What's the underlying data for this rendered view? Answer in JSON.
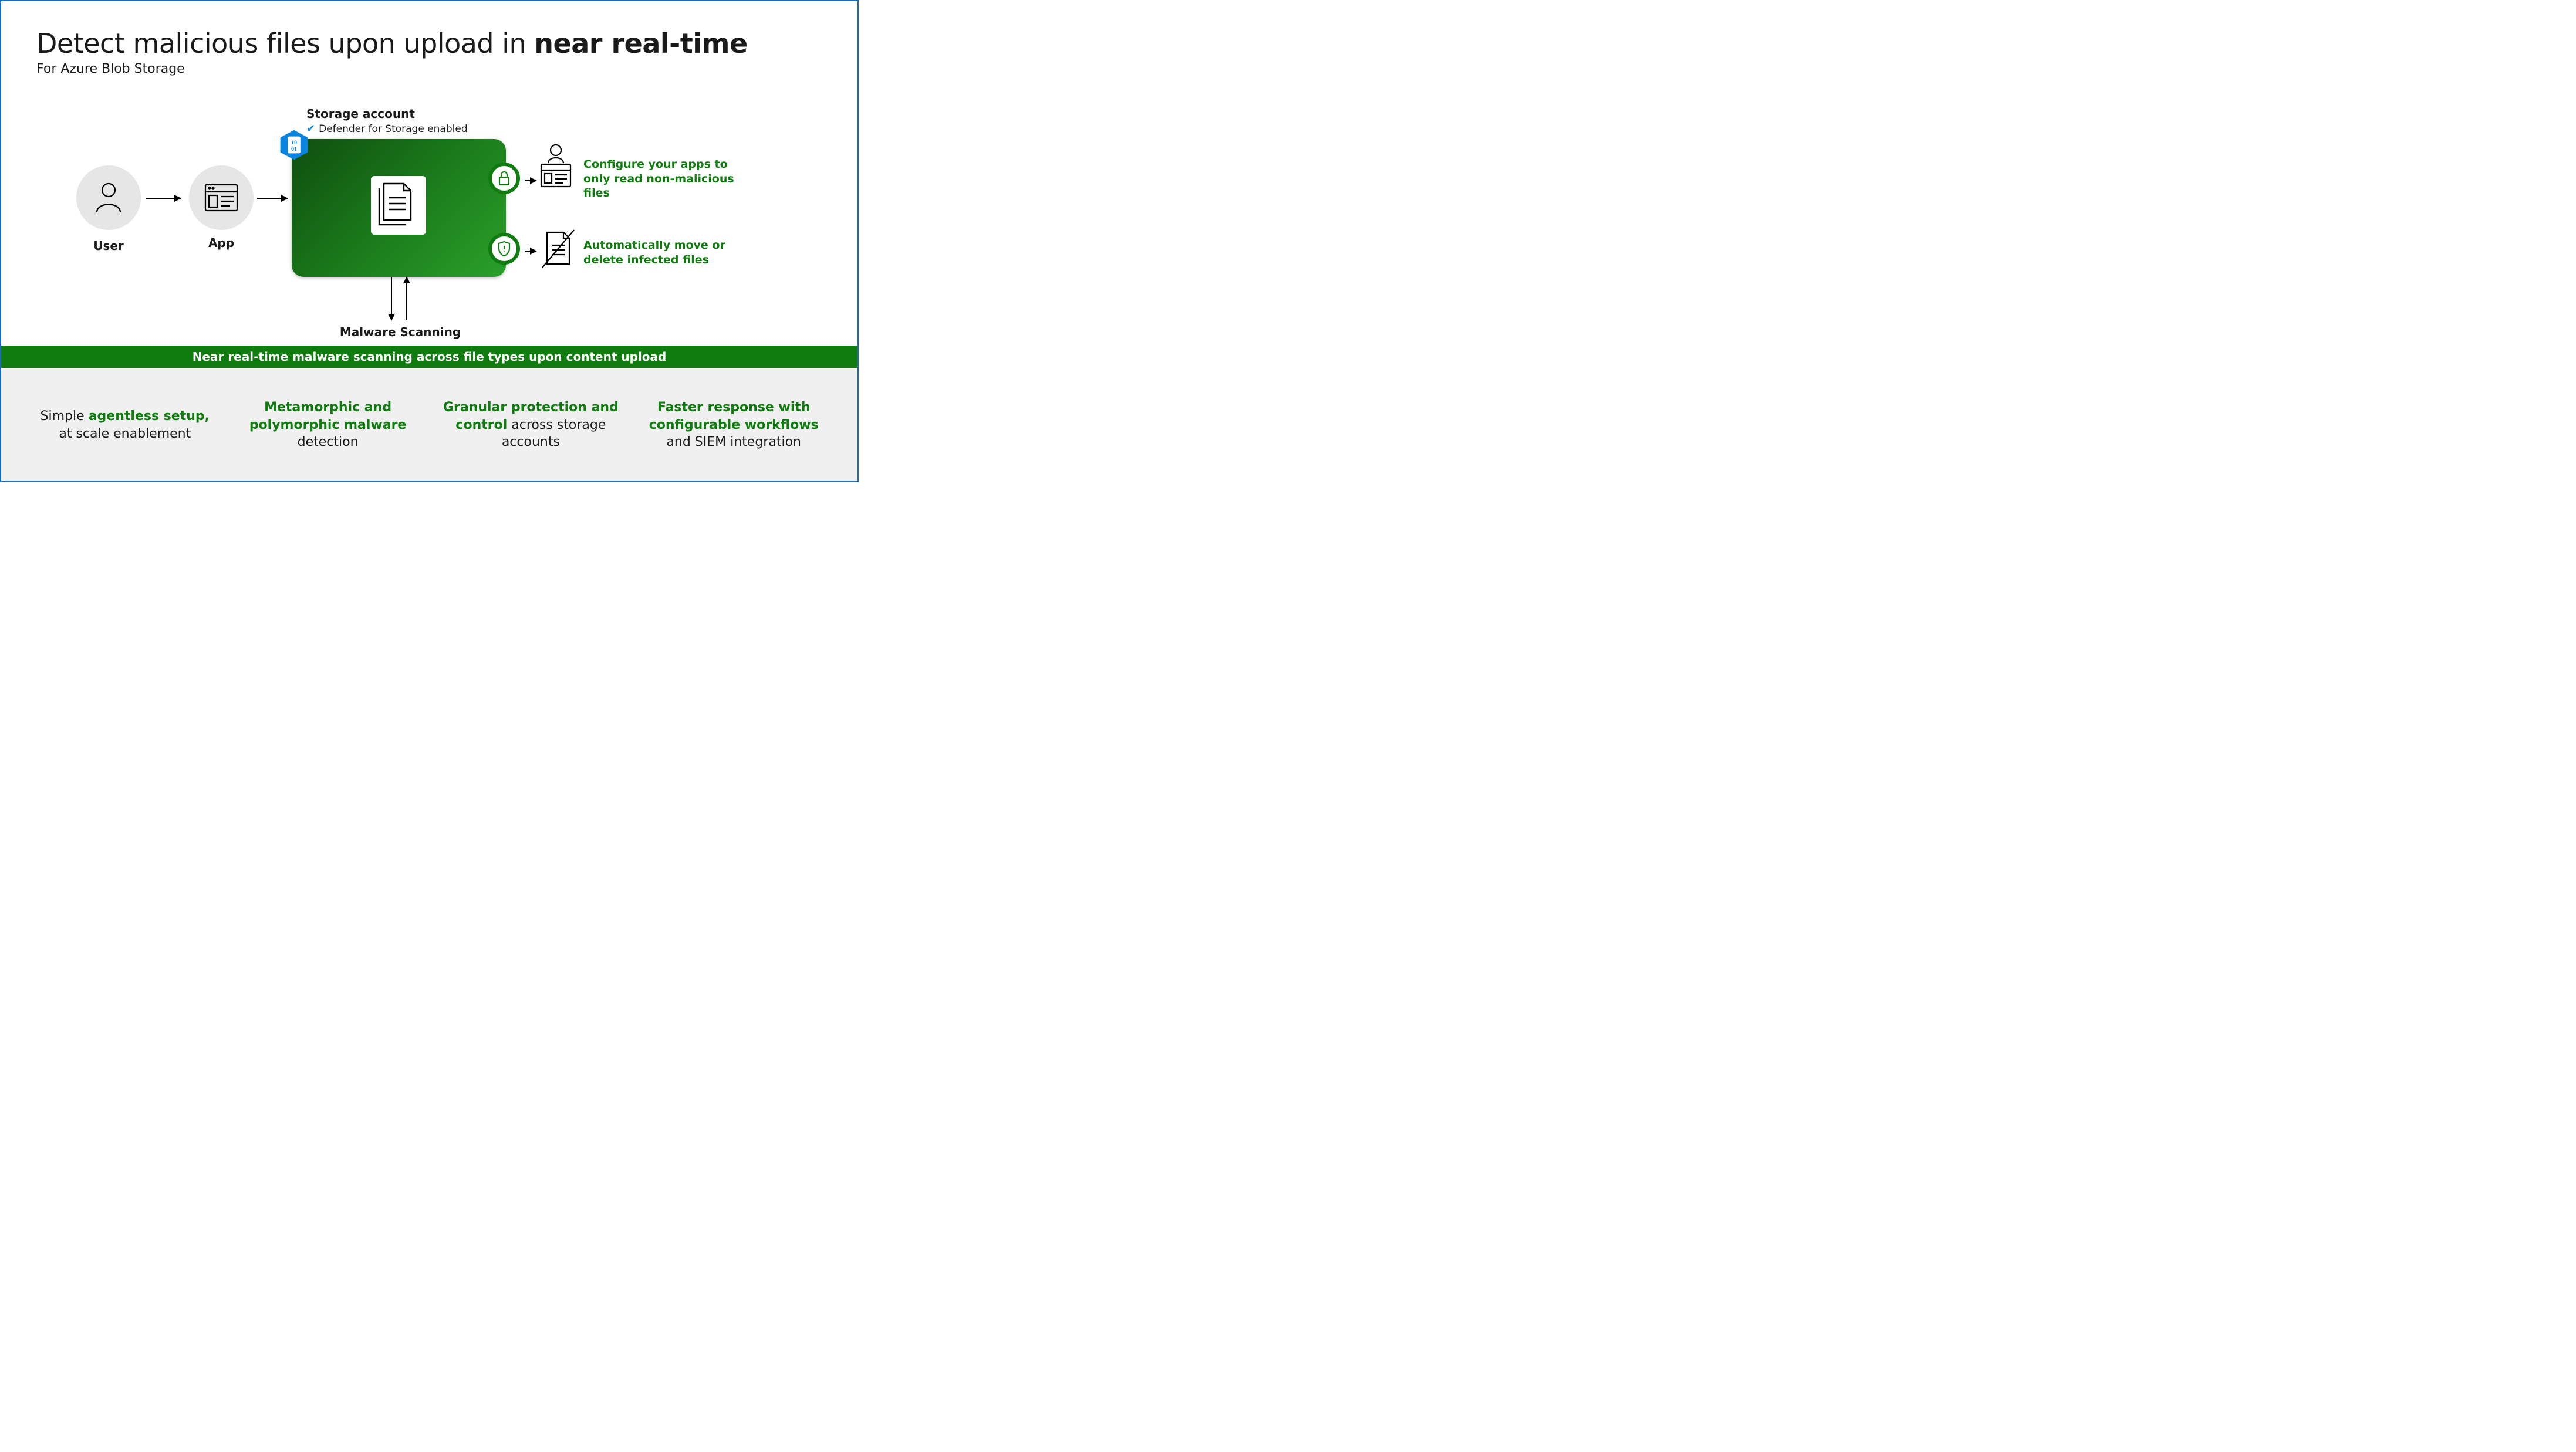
{
  "header": {
    "title_plain": "Detect malicious files upon upload in ",
    "title_bold": "near real-time",
    "subtitle": "For Azure Blob Storage"
  },
  "flow": {
    "user_label": "User",
    "app_label": "App",
    "storage_label": "Storage account",
    "defender_enabled": "Defender for Storage enabled",
    "hex_code": "10\n01",
    "malware_label": "Malware Scanning",
    "outcome_configure": "Configure your apps to only read non-malicious files",
    "outcome_delete": "Automatically move or delete infected files"
  },
  "banner": "Near real-time malware scanning across file types upon content upload",
  "features": [
    {
      "pre": "Simple ",
      "hl": "agentless setup,",
      "post": " at scale enablement"
    },
    {
      "pre": "",
      "hl": "Metamorphic and polymorphic malware",
      "post": " detection"
    },
    {
      "pre": "",
      "hl": "Granular protection and control",
      "post": " across storage accounts"
    },
    {
      "pre": "",
      "hl": "Faster response with configurable workflows",
      "post": " and SIEM integration"
    }
  ]
}
